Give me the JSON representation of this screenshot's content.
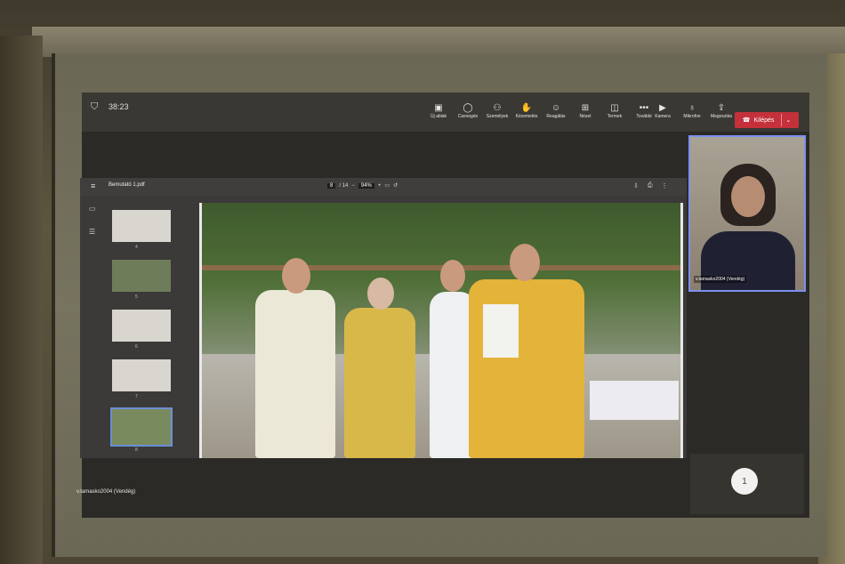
{
  "meeting": {
    "timer": "38:23"
  },
  "toolbar": {
    "items": [
      {
        "icon": "chat-new-icon",
        "label": "Új ablak"
      },
      {
        "icon": "chat-icon",
        "label": "Csevegés"
      },
      {
        "icon": "people-icon",
        "label": "Személyek"
      },
      {
        "icon": "raise-hand-icon",
        "label": "Kézemelés"
      },
      {
        "icon": "reactions-icon",
        "label": "Reagálás"
      },
      {
        "icon": "view-icon",
        "label": "Nézet"
      },
      {
        "icon": "rooms-icon",
        "label": "Termek"
      },
      {
        "icon": "more-icon",
        "label": "További"
      }
    ],
    "media": [
      {
        "icon": "camera-icon",
        "label": "Kamera"
      },
      {
        "icon": "microphone-icon",
        "label": "Mikrofon"
      },
      {
        "icon": "share-icon",
        "label": "Megosztás"
      }
    ],
    "leave_label": "Kilépés"
  },
  "pdf": {
    "filename": "Bemutató 1.pdf",
    "page_current": "8",
    "page_total": "/ 14",
    "zoom": "94%",
    "thumbnails": [
      {
        "number": "4"
      },
      {
        "number": "5"
      },
      {
        "number": "6"
      },
      {
        "number": "7"
      },
      {
        "number": "8"
      }
    ]
  },
  "participant": {
    "name": "v.tamasko2004 (Vendég)"
  },
  "presenter": {
    "name": "v.tamasko2004 (Vendég)"
  },
  "participant_count": "1",
  "colors": {
    "leave": "#c4313a",
    "accent": "#7d8ff0"
  }
}
